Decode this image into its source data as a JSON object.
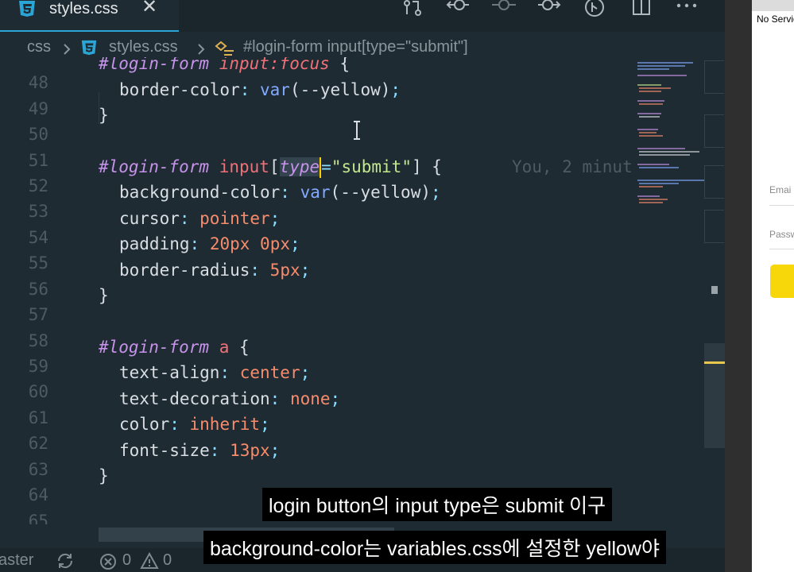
{
  "tab": {
    "title": "styles.css",
    "close": "✕"
  },
  "breadcrumb": {
    "folder": "css",
    "file": "styles.css",
    "symbol": "#login-form input[type=\"submit\"]"
  },
  "lines": [
    {
      "n": "48"
    },
    {
      "n": "49"
    },
    {
      "n": "50"
    },
    {
      "n": "51"
    },
    {
      "n": "52"
    },
    {
      "n": "53"
    },
    {
      "n": "54"
    },
    {
      "n": "55"
    },
    {
      "n": "56"
    },
    {
      "n": "57"
    },
    {
      "n": "58"
    },
    {
      "n": "59"
    },
    {
      "n": "60"
    },
    {
      "n": "61"
    },
    {
      "n": "62"
    },
    {
      "n": "63"
    },
    {
      "n": "64"
    },
    {
      "n": "65"
    }
  ],
  "code": {
    "l48": {
      "sel": "#login-form",
      "el": " input:focus",
      "brace": " {"
    },
    "l49": {
      "prop": "border-color",
      "colon": ": ",
      "fn": "var",
      "open": "(",
      "arg": "--yellow",
      "close": ")",
      "semi": ";"
    },
    "l50": "}",
    "l52": {
      "sel": "#login-form",
      "el": " input",
      "lb": "[",
      "attr": "type",
      "eq": "=",
      "val": "\"submit\"",
      "rb": "]",
      "brace": " {",
      "blame": "You, 2 minut"
    },
    "l53": {
      "prop": "background-color",
      "colon": ": ",
      "fn": "var",
      "open": "(",
      "arg": "--yellow",
      "close": ")",
      "semi": ";"
    },
    "l54": {
      "prop": "cursor",
      "colon": ": ",
      "val": "pointer",
      "semi": ";"
    },
    "l55": {
      "prop": "padding",
      "colon": ": ",
      "v1": "20px",
      "sp": " ",
      "v2": "0px",
      "semi": ";"
    },
    "l56": {
      "prop": "border-radius",
      "colon": ": ",
      "val": "5px",
      "semi": ";"
    },
    "l57": "}",
    "l59": {
      "sel": "#login-form",
      "el": " a",
      "brace": " {"
    },
    "l60": {
      "prop": "text-align",
      "colon": ": ",
      "val": "center",
      "semi": ";"
    },
    "l61": {
      "prop": "text-decoration",
      "colon": ": ",
      "val": "none",
      "semi": ";"
    },
    "l62": {
      "prop": "color",
      "colon": ": ",
      "val": "inherit",
      "semi": ";"
    },
    "l63": {
      "prop": "font-size",
      "colon": ": ",
      "val": "13px",
      "semi": ";"
    },
    "l64": "}"
  },
  "status": {
    "branch": "aster",
    "errors": "0",
    "warnings": "0"
  },
  "browser": {
    "title": "No Servic",
    "email_placeholder": "Emai",
    "password_placeholder": "Passw"
  },
  "subtitles": {
    "line1": "login button의 input type은 submit 이구",
    "line2": "background-color는 variables.css에 설정한 yellow야"
  }
}
